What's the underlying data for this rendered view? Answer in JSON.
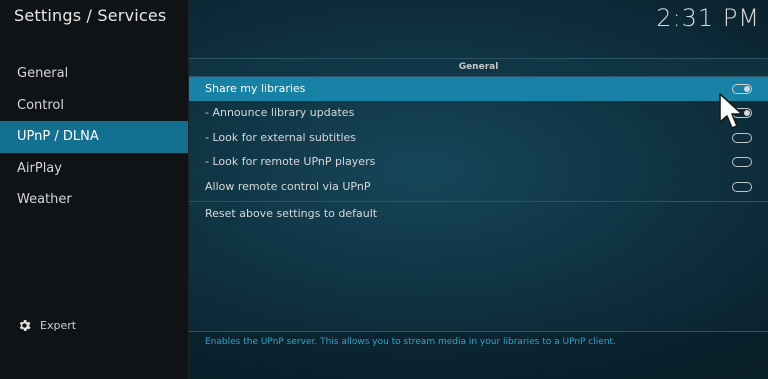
{
  "window": {
    "title": "Settings / Services",
    "clock": "2:31 PM"
  },
  "sidebar": {
    "items": [
      {
        "label": "General",
        "active": false
      },
      {
        "label": "Control",
        "active": false
      },
      {
        "label": "UPnP / DLNA",
        "active": true
      },
      {
        "label": "AirPlay",
        "active": false
      },
      {
        "label": "Weather",
        "active": false
      }
    ],
    "expert_label": "Expert",
    "expert_icon": "gear-icon"
  },
  "content": {
    "section_header": "General",
    "settings": [
      {
        "label": "Share my libraries",
        "enabled": true,
        "focused": true
      },
      {
        "label": "- Announce library updates",
        "enabled": true,
        "focused": false
      },
      {
        "label": "- Look for external subtitles",
        "enabled": false,
        "focused": false
      },
      {
        "label": "- Look for remote UPnP players",
        "enabled": false,
        "focused": false
      },
      {
        "label": "Allow remote control via UPnP",
        "enabled": false,
        "focused": false
      }
    ],
    "reset_label": "Reset above settings to default"
  },
  "footer": {
    "help_text": "Enables the UPnP server. This allows you to stream media in your libraries to a UPnP client."
  },
  "colors": {
    "accent": "#1782a6",
    "sidebar_active": "#137090",
    "help_text": "#2ea3c8"
  }
}
